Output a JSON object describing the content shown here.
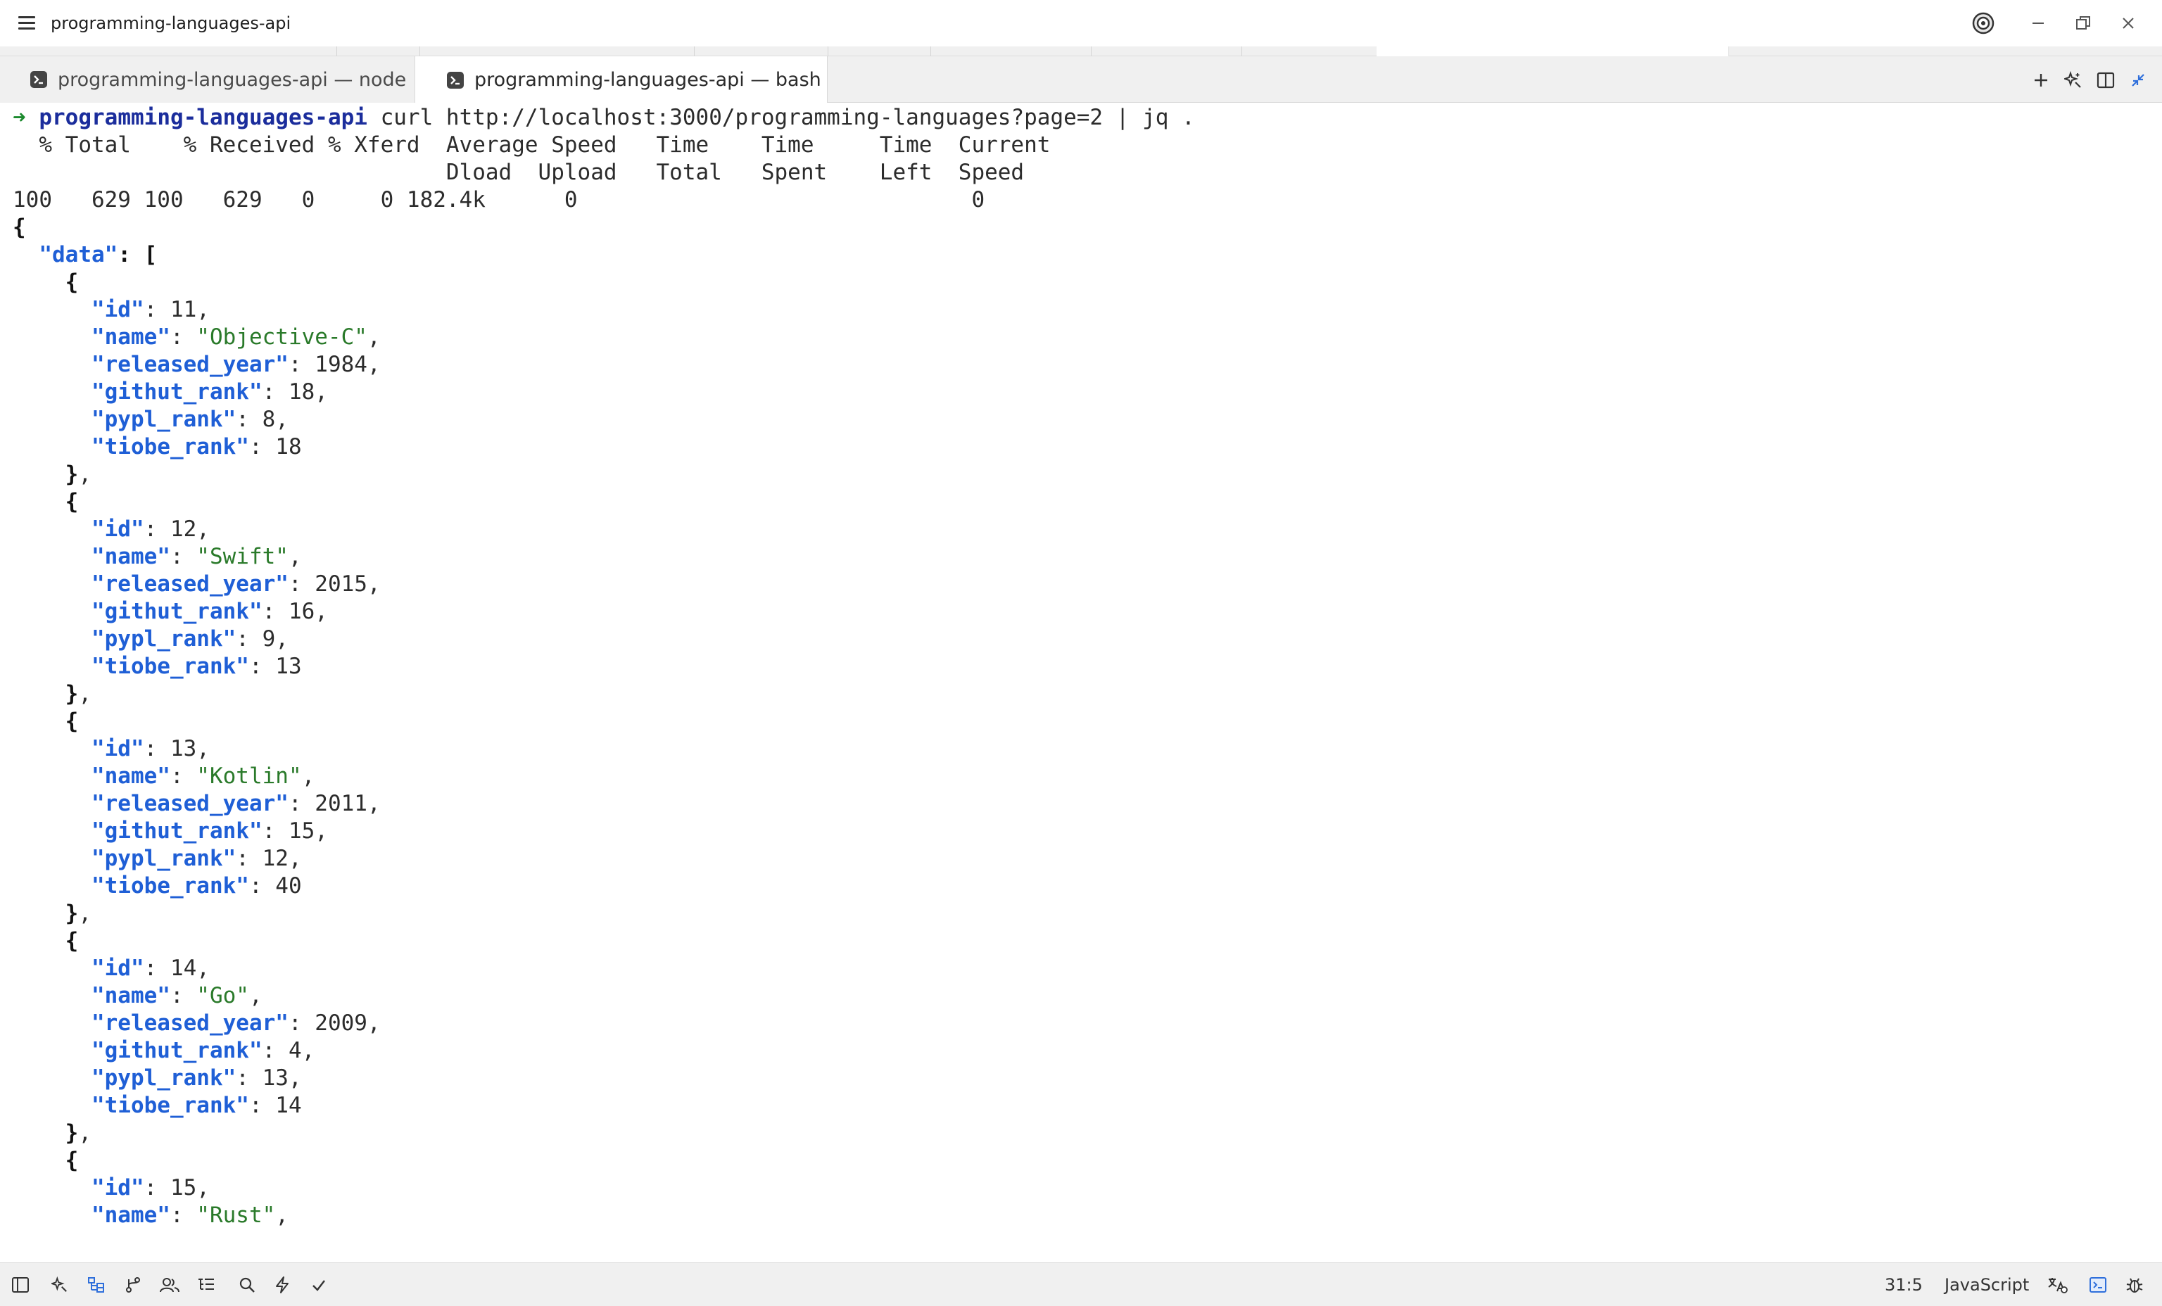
{
  "window": {
    "title": "programming-languages-api"
  },
  "tabs": [
    {
      "label": "programming-languages-api — node",
      "active": false
    },
    {
      "label": "programming-languages-api — bash",
      "active": true
    }
  ],
  "terminal": {
    "prompt_arrow": "➜",
    "prompt_dir": "programming-languages-api",
    "command": " curl http://localhost:3000/programming-languages?page=2 | jq .",
    "progress_header_1": "  % Total    % Received % Xferd  Average Speed   Time    Time     Time  Current",
    "progress_header_2": "                                 Dload  Upload   Total   Spent    Left  Speed",
    "progress_values": "100   629 100   629   0     0 182.4k      0                              0",
    "json_open": "{",
    "data_key": "\"data\"",
    "data_open": ": [",
    "records": [
      {
        "id": "11",
        "name": "\"Objective-C\"",
        "released_year": "1984",
        "githut_rank": "18",
        "pypl_rank": "8",
        "tiobe_rank": "18"
      },
      {
        "id": "12",
        "name": "\"Swift\"",
        "released_year": "2015",
        "githut_rank": "16",
        "pypl_rank": "9",
        "tiobe_rank": "13"
      },
      {
        "id": "13",
        "name": "\"Kotlin\"",
        "released_year": "2011",
        "githut_rank": "15",
        "pypl_rank": "12",
        "tiobe_rank": "40"
      },
      {
        "id": "14",
        "name": "\"Go\"",
        "released_year": "2009",
        "githut_rank": "4",
        "pypl_rank": "13",
        "tiobe_rank": "14"
      }
    ],
    "last_record": {
      "id": "15",
      "name": "\"Rust\""
    },
    "keys": {
      "id": "\"id\"",
      "name": "\"name\"",
      "released_year": "\"released_year\"",
      "githut_rank": "\"githut_rank\"",
      "pypl_rank": "\"pypl_rank\"",
      "tiobe_rank": "\"tiobe_rank\""
    }
  },
  "statusbar": {
    "cursor_position": "31:5",
    "language": "JavaScript"
  },
  "colors": {
    "prompt_arrow": "#1c8a2e",
    "prompt_dir": "#1b2d9c",
    "json_key": "#1f5fd6",
    "json_string": "#2a7a2a",
    "accent": "#2f6fdb"
  },
  "icons": {
    "titlebar": [
      "menu-icon",
      "copilot-icon",
      "minimize-icon",
      "restore-icon",
      "close-icon"
    ],
    "tabbar": [
      "terminal-icon",
      "add-icon",
      "ai-sparkle-icon",
      "split-pane-icon",
      "collapse-icon"
    ],
    "statusbar_left": [
      "toggle-sidebar-icon",
      "ai-sparkle-icon",
      "project-panel-icon",
      "git-branch-icon",
      "collaborators-icon",
      "outline-icon",
      "search-icon",
      "lightning-icon",
      "check-icon"
    ],
    "statusbar_right": [
      "language-server-icon",
      "terminal-panel-icon",
      "debug-icon"
    ]
  }
}
